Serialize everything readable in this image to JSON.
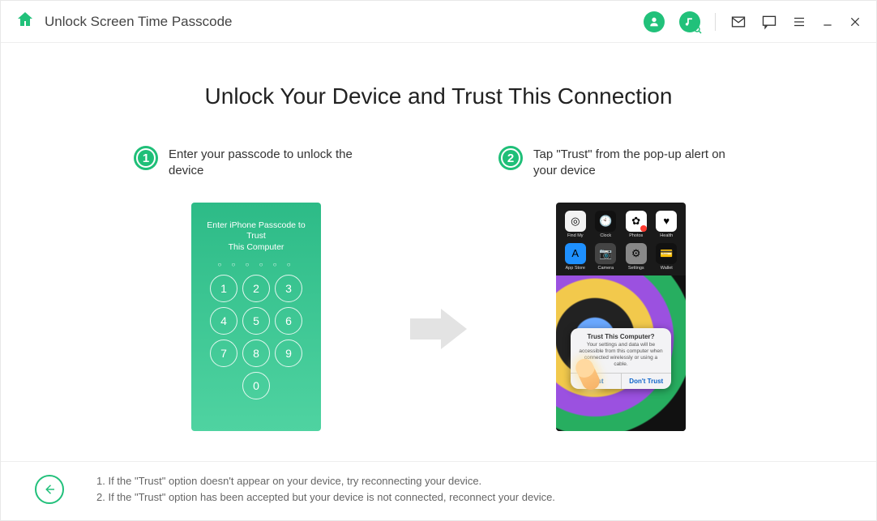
{
  "header": {
    "title": "Unlock Screen Time Passcode"
  },
  "main": {
    "title": "Unlock Your Device and Trust This Connection",
    "steps": [
      {
        "num": "1",
        "label": "Enter your passcode to unlock the device"
      },
      {
        "num": "2",
        "label": "Tap \"Trust\" from the pop-up alert on your device"
      }
    ]
  },
  "phone_left": {
    "title_line1": "Enter iPhone Passcode to Trust",
    "title_line2": "This Computer",
    "keys": [
      "1",
      "2",
      "3",
      "4",
      "5",
      "6",
      "7",
      "8",
      "9",
      "0"
    ]
  },
  "phone_right": {
    "apps": [
      {
        "name": "Find My",
        "bg": "#f2f2f2",
        "glyph": "◎"
      },
      {
        "name": "Clock",
        "bg": "#111",
        "glyph": "🕙"
      },
      {
        "name": "Photos",
        "bg": "#fff",
        "glyph": "✿"
      },
      {
        "name": "Health",
        "bg": "#fff",
        "glyph": "♥"
      },
      {
        "name": "App Store",
        "bg": "#1e90ff",
        "glyph": "A"
      },
      {
        "name": "Camera",
        "bg": "#444",
        "glyph": "📷"
      },
      {
        "name": "Settings",
        "bg": "#888",
        "glyph": "⚙"
      },
      {
        "name": "Wallet",
        "bg": "#111",
        "glyph": "💳"
      }
    ],
    "popup": {
      "title": "Trust This Computer?",
      "body": "Your settings and data will be accessible from this computer when connected wirelessly or using a cable.",
      "trust": "Trust",
      "dont_trust": "Don't Trust"
    }
  },
  "footer": {
    "note1": "1. If the \"Trust\" option doesn't appear on your device, try reconnecting your device.",
    "note2": "2. If the \"Trust\" option has been accepted but your device is not connected, reconnect your device."
  }
}
